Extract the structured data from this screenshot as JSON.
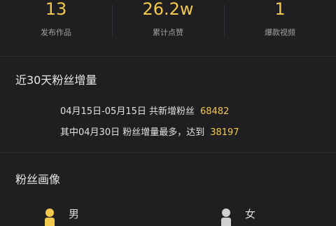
{
  "stats": [
    {
      "value": "13",
      "label": "发布作品"
    },
    {
      "value": "26.2w",
      "label": "累计点赞"
    },
    {
      "value": "1",
      "label": "爆款视频"
    }
  ],
  "growth": {
    "title": "近30天粉丝增量",
    "range_text": "04月15日-05月15日 共新增粉丝",
    "range_value": "68482",
    "peak_text": "其中04月30日 粉丝增量最多，达到",
    "peak_value": "38197"
  },
  "profile": {
    "title": "粉丝画像",
    "male_label": "男",
    "female_label": "女"
  },
  "colors": {
    "accent": "#f2c94c",
    "background": "#1f1f22"
  }
}
